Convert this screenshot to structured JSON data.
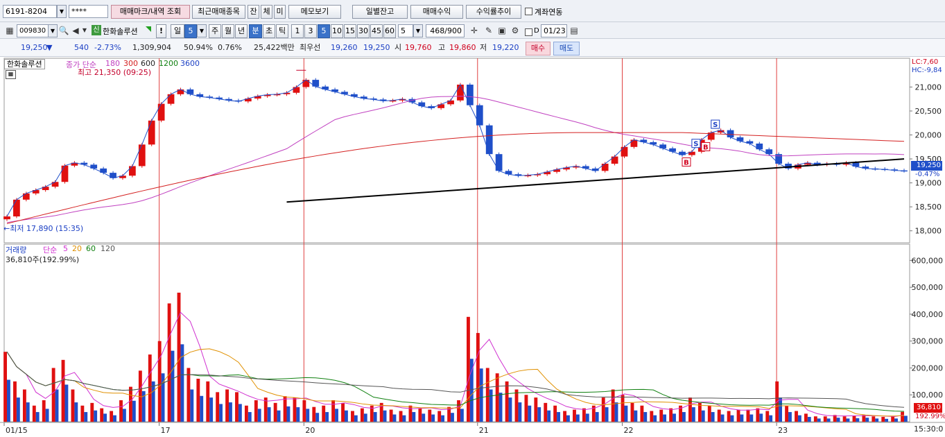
{
  "toolbar1": {
    "account": "6191-8204",
    "password": "****",
    "btn_trade_mark": "매매마크/내역 조회",
    "btn_recent_items": "최근매매종목",
    "btn_jan": "잔",
    "btn_che": "체",
    "btn_mi": "미",
    "btn_memo": "메모보기",
    "btn_daily_balance": "일별잔고",
    "btn_trade_profit": "매매수익",
    "btn_yield_trend": "수익률추이",
    "account_link_label": "계좌연동"
  },
  "toolbar2": {
    "stock_code": "009830",
    "credit_badge": "신",
    "stock_name": "한화솔루션",
    "alert_mark": "!",
    "period_day": "일",
    "period_value": "5",
    "periods": [
      "주",
      "월",
      "년"
    ],
    "unit_min": "분",
    "unit_sec": "초",
    "unit_tick": "틱",
    "intervals": [
      "1",
      "3",
      "5",
      "10",
      "15",
      "30",
      "45",
      "60"
    ],
    "selected_interval": "5",
    "count_value": "5",
    "count_display": "468/900",
    "date_value": "01/23",
    "d_label": "D",
    "icons": [
      "calculator-icon",
      "search-icon",
      "speaker-icon",
      "crosshair-icon",
      "edit-icon",
      "save-icon",
      "settings-icon",
      "calendar-icon"
    ]
  },
  "quote": {
    "price": "19,250",
    "change_arrow": "▼",
    "change": "540",
    "change_rate": "-2.73%",
    "volume": "1,309,904",
    "volume_ratio": "50.94%",
    "turnover_rate": "0.76%",
    "amount": "25,422백만",
    "best_label": "최우선",
    "best_ask": "19,260",
    "best_bid": "19,250",
    "open_label": "시",
    "open": "19,760",
    "high_label": "고",
    "high": "19,860",
    "low_label": "저",
    "low": "19,220",
    "buy_button": "매수",
    "sell_button": "매도"
  },
  "price_panel": {
    "stock_name": "한화솔루션",
    "ma_label": "종가 단순",
    "ma_periods": [
      "180",
      "300",
      "600",
      "1200",
      "3600"
    ],
    "high_note": "최고 21,350 (09:25)",
    "low_note": "←최저 17,890 (15:35)",
    "lc_label": "LC:7,60",
    "hc_label": "HC:-9,84",
    "current_tag": "19,250",
    "current_pct": "-0.47%"
  },
  "volume_panel": {
    "title": "거래량",
    "ma_label": "단순",
    "ma_periods": [
      "5",
      "20",
      "60",
      "120"
    ],
    "last_info": "36,810주(192.99%)",
    "current_tag": "36,810",
    "current_pct": "192.99%"
  },
  "time_axis": {
    "labels": [
      "01/15",
      "17",
      "20",
      "21",
      "22",
      "23"
    ],
    "right_label": "15:30:0"
  },
  "trade_marks": [
    "B",
    "S",
    "B",
    "S"
  ],
  "colors": {
    "up": "#e01010",
    "down": "#1f4fc9",
    "ma180": "#c040c0",
    "ma300": "#d42020",
    "ma600": "#222222",
    "ma1200": "#108010",
    "ma3600": "#1b3fc4",
    "vol_ma5": "#d030d0",
    "vol_ma20": "#e09000",
    "vol_ma60": "#108010",
    "vol_ma120": "#555555"
  },
  "chart_data": [
    {
      "type": "line",
      "title": "한화솔루션",
      "ylabel": "",
      "xlabel": "",
      "ylim": [
        17750,
        21600
      ],
      "y_ticks": [
        18000,
        18500,
        19000,
        19500,
        20000,
        20500,
        21000
      ],
      "x_labels": [
        "01/15",
        "17",
        "20",
        "21",
        "22",
        "23"
      ],
      "x": [
        0,
        5,
        10,
        15,
        20,
        25,
        30,
        35,
        40,
        45,
        50,
        55,
        60,
        65,
        70,
        75,
        80,
        85,
        90,
        95,
        100,
        105,
        110,
        115,
        120,
        125,
        130,
        135,
        140,
        145,
        150,
        155,
        160,
        165,
        170,
        175,
        180,
        185,
        190,
        195,
        200,
        205,
        210,
        215,
        220,
        225,
        230,
        235,
        240,
        245,
        250,
        255,
        260,
        265,
        270,
        275,
        280,
        285,
        290,
        295,
        300,
        305,
        310,
        315,
        320,
        325,
        330,
        335,
        340,
        345,
        350,
        355,
        360,
        365,
        370,
        375,
        380,
        385,
        390,
        395,
        400,
        405,
        410,
        415,
        420,
        425,
        430,
        435,
        440,
        445,
        450,
        455,
        460,
        465
      ],
      "series": [
        {
          "name": "close",
          "values": [
            18300,
            18650,
            18780,
            18850,
            18920,
            19020,
            19360,
            19420,
            19380,
            19300,
            19210,
            19100,
            19150,
            19350,
            19800,
            20300,
            20650,
            20850,
            20950,
            20850,
            20800,
            20780,
            20750,
            20720,
            20700,
            20760,
            20810,
            20840,
            20850,
            20880,
            21000,
            21150,
            21010,
            20950,
            20900,
            20850,
            20800,
            20760,
            20740,
            20710,
            20720,
            20750,
            20680,
            20600,
            20560,
            20640,
            20720,
            21050,
            20620,
            20200,
            19600,
            19250,
            19180,
            19150,
            19160,
            19180,
            19230,
            19280,
            19320,
            19350,
            19300,
            19250,
            19400,
            19550,
            19750,
            19900,
            19850,
            19800,
            19720,
            19650,
            19580,
            19650,
            19900,
            20050,
            20100,
            19950,
            19870,
            19820,
            19700,
            19600,
            19400,
            19300,
            19380,
            19420,
            19380,
            19400,
            19380,
            19420,
            19340,
            19300,
            19290,
            19280,
            19260,
            19250
          ]
        }
      ]
    },
    {
      "type": "bar",
      "title": "거래량",
      "ylim": [
        0,
        650000
      ],
      "y_ticks": [
        100000,
        200000,
        300000,
        400000,
        500000,
        600000
      ],
      "series": [
        {
          "name": "volume",
          "values": [
            260000,
            150000,
            120000,
            60000,
            80000,
            200000,
            230000,
            120000,
            60000,
            70000,
            50000,
            40000,
            80000,
            130000,
            190000,
            250000,
            300000,
            440000,
            480000,
            200000,
            160000,
            150000,
            110000,
            120000,
            110000,
            60000,
            80000,
            90000,
            70000,
            95000,
            90000,
            80000,
            55000,
            60000,
            80000,
            70000,
            40000,
            50000,
            60000,
            70000,
            45000,
            40000,
            60000,
            50000,
            45000,
            40000,
            55000,
            80000,
            390000,
            330000,
            200000,
            180000,
            150000,
            120000,
            100000,
            90000,
            70000,
            60000,
            40000,
            45000,
            50000,
            60000,
            90000,
            120000,
            100000,
            70000,
            60000,
            40000,
            45000,
            50000,
            60000,
            90000,
            70000,
            60000,
            45000,
            40000,
            45000,
            45000,
            50000,
            40000,
            150000,
            60000,
            40000,
            30000,
            20000,
            20000,
            25000,
            20000,
            22000,
            25000,
            20000,
            18000,
            20000,
            36810
          ]
        }
      ]
    }
  ]
}
